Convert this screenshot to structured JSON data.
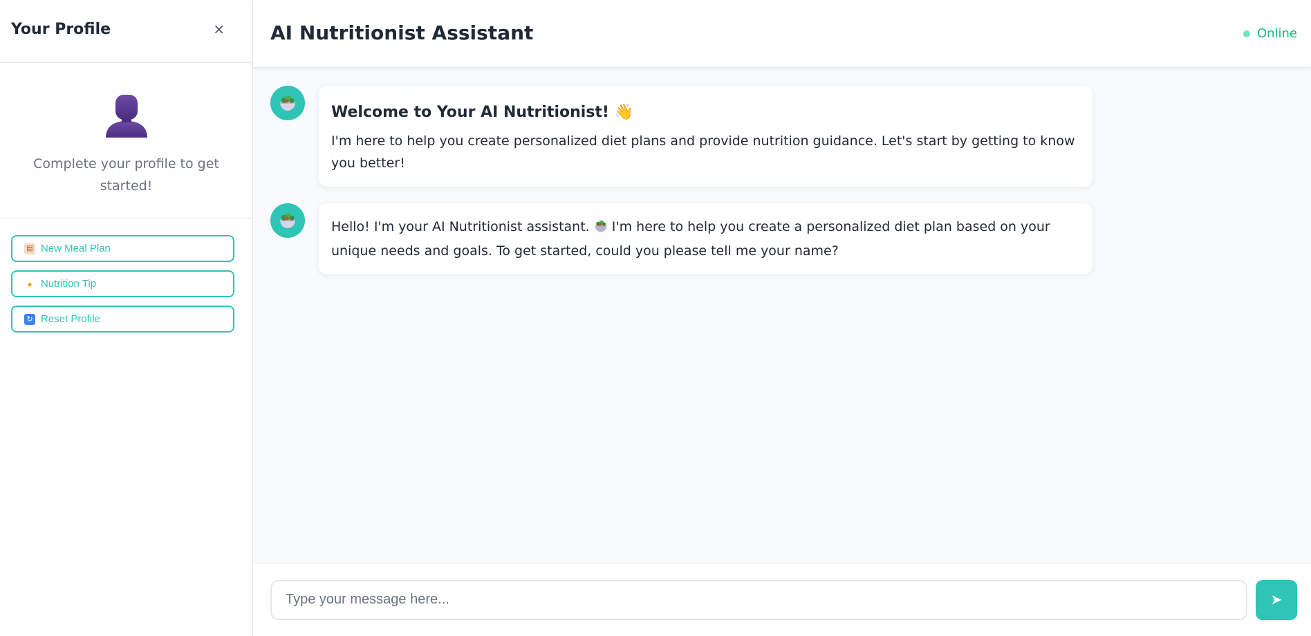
{
  "sidebar": {
    "title": "Your Profile",
    "close_label": "×",
    "profile_prompt": "Complete your profile to get started!",
    "actions": [
      {
        "icon": "clipboard-icon",
        "label": "New Meal Plan"
      },
      {
        "icon": "lightbulb-icon",
        "label": "Nutrition Tip"
      },
      {
        "icon": "reset-icon",
        "label": "Reset Profile"
      }
    ]
  },
  "header": {
    "title": "AI Nutritionist Assistant",
    "status": "Online"
  },
  "messages": [
    {
      "sender": "bot",
      "avatar_icon": "salad-icon",
      "heading": "Welcome to Your AI Nutritionist! 👋",
      "text": "I'm here to help you create personalized diet plans and provide nutrition guidance. Let's start by getting to know you better!"
    },
    {
      "sender": "bot",
      "avatar_icon": "salad-icon",
      "text_before": "Hello! I'm your AI Nutritionist assistant.",
      "text_after": "I'm here to help you create a personalized diet plan based on your unique needs and goals. To get started, could you please tell me your name?"
    }
  ],
  "composer": {
    "placeholder": "Type your message here...",
    "value": "",
    "send_label": "➤"
  },
  "colors": {
    "accent": "#2ec4b6",
    "status_green": "#10b981",
    "avatar_purple": "#5b3a8e"
  }
}
